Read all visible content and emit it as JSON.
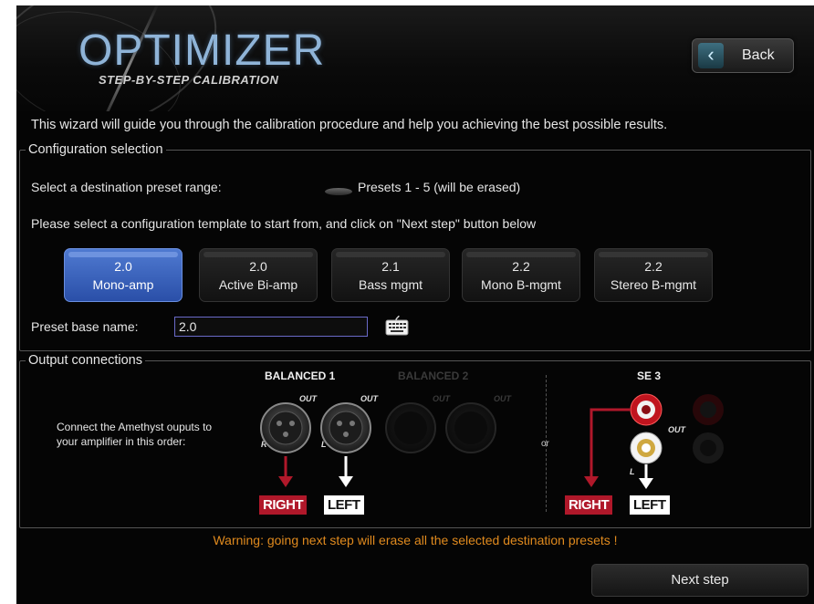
{
  "header": {
    "title": "OPTIMIZER",
    "subtitle": "STEP-BY-STEP CALIBRATION",
    "back_label": "Back"
  },
  "intro_text": "This wizard will guide you through the calibration procedure and help you achieving the best possible results.",
  "config": {
    "legend": "Configuration selection",
    "preset_range_label": "Select a destination preset range:",
    "preset_range_value": "Presets 1 - 5 (will be erased)",
    "template_prompt": "Please select a configuration template to start from, and click on \"Next step\" button below",
    "templates": [
      {
        "line1": "2.0",
        "line2": "Mono-amp",
        "selected": true
      },
      {
        "line1": "2.0",
        "line2": "Active Bi-amp",
        "selected": false
      },
      {
        "line1": "2.1",
        "line2": "Bass mgmt",
        "selected": false
      },
      {
        "line1": "2.2",
        "line2": "Mono B-mgmt",
        "selected": false
      },
      {
        "line1": "2.2",
        "line2": "Stereo B-mgmt",
        "selected": false
      }
    ],
    "preset_name_label": "Preset base name:",
    "preset_name_value": "2.0",
    "keyboard_icon": "keyboard-icon"
  },
  "output": {
    "legend": "Output connections",
    "instruction": "Connect the Amethyst ouputs to your amplifier in this order:",
    "balanced1_label": "BALANCED 1",
    "balanced2_label": "BALANCED 2",
    "se3_label": "SE 3",
    "out_label": "OUT",
    "r_label": "R",
    "l_label": "L",
    "or_label": "or",
    "right_tag": "RIGHT",
    "left_tag": "LEFT"
  },
  "warning": "Warning: going next step will erase all the selected destination presets !",
  "next_label": "Next step",
  "colors": {
    "selected_template": "#3f68c4",
    "warning": "#e08a1e",
    "right_red": "#b0182a",
    "logo_blue": "#8fb4d8"
  }
}
